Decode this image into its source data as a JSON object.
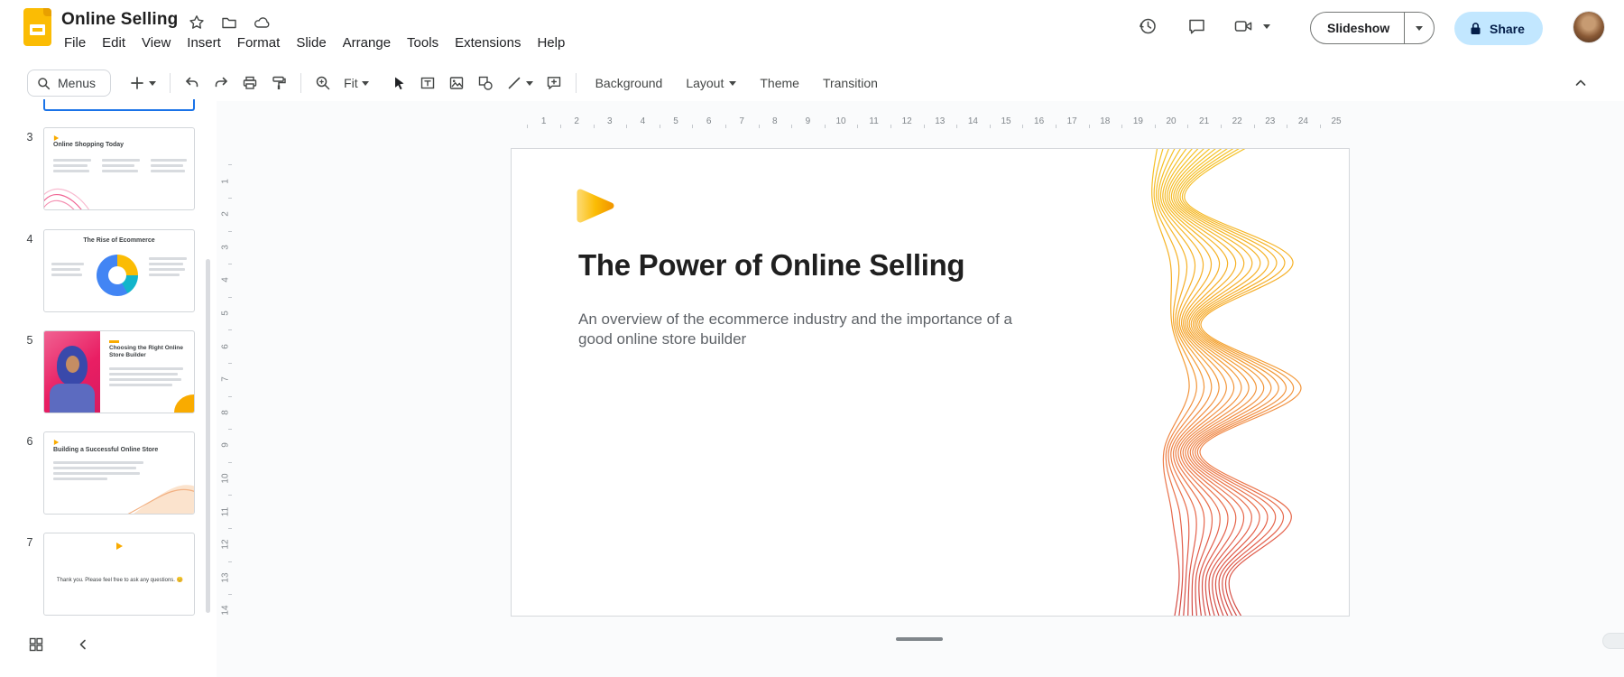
{
  "header": {
    "doc_title": "Online Selling",
    "menu_items": [
      "File",
      "Edit",
      "View",
      "Insert",
      "Format",
      "Slide",
      "Arrange",
      "Tools",
      "Extensions",
      "Help"
    ],
    "actions": {
      "slideshow": "Slideshow",
      "share": "Share"
    }
  },
  "toolbar": {
    "menus_label": "Menus",
    "zoom_value": "Fit",
    "buttons": {
      "background": "Background",
      "layout": "Layout",
      "theme": "Theme",
      "transition": "Transition"
    }
  },
  "rulers": {
    "horizontal": [
      "1",
      "2",
      "3",
      "4",
      "5",
      "6",
      "7",
      "8",
      "9",
      "10",
      "11",
      "12",
      "13",
      "14",
      "15",
      "16",
      "17",
      "18",
      "19",
      "20",
      "21",
      "22",
      "23",
      "24",
      "25"
    ],
    "vertical": [
      "1",
      "2",
      "3",
      "4",
      "5",
      "6",
      "7",
      "8",
      "9",
      "10",
      "11",
      "12",
      "13",
      "14"
    ]
  },
  "filmstrip": {
    "slides": [
      {
        "number": "3",
        "title": "Online Shopping Today"
      },
      {
        "number": "4",
        "title": "The Rise of Ecommerce"
      },
      {
        "number": "5",
        "title": "Choosing the Right Online Store Builder"
      },
      {
        "number": "6",
        "title": "Building a Successful Online Store"
      },
      {
        "number": "7",
        "title": "Thank you. Please feel free to ask any questions. 😊"
      }
    ]
  },
  "slide": {
    "title": "The Power of Online Selling",
    "subtitle": "An overview of the ecommerce industry and the importance of a good online store builder"
  },
  "colors": {
    "accent_blue": "#1a73e8",
    "share_pill": "#c2e7ff",
    "logo_yellow": "#fbbc04",
    "wave_start": "#f3b700",
    "wave_end": "#c21f1f",
    "donut_blue": "#4285f4",
    "donut_orange": "#fbbc04",
    "donut_teal": "#12b5cb",
    "photo_pink": "#e91e63"
  }
}
